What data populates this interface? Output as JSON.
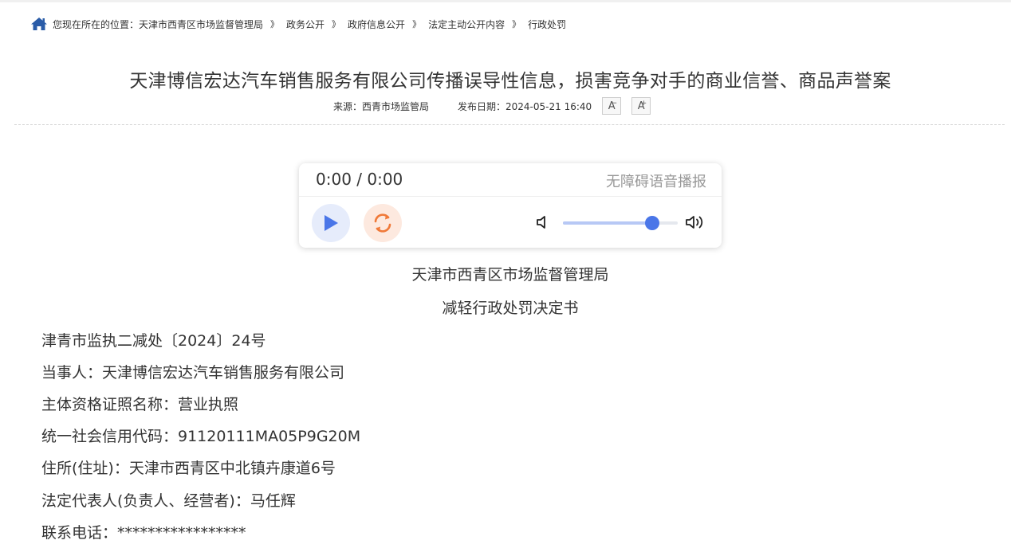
{
  "breadcrumb": {
    "prefix": "您现在所在的位置：",
    "items": [
      "天津市西青区市场监督管理局",
      "政务公开",
      "政府信息公开",
      "法定主动公开内容",
      "行政处罚"
    ],
    "separator": "》"
  },
  "article": {
    "title": "天津博信宏达汽车销售服务有限公司传播误导性信息，损害竞争对手的商业信誉、商品声誉案",
    "source": "来源：西青市场监管局",
    "date": "发布日期：2024-05-21 16:40",
    "font_decrease": "A",
    "font_decrease_mark": "−",
    "font_increase": "A",
    "font_increase_mark": "+"
  },
  "player": {
    "time": "0:00 / 0:00",
    "label": "无障碍语音播报",
    "volume_percent": 78
  },
  "document": {
    "agency": "天津市西青区市场监督管理局",
    "doc_title": "减轻行政处罚决定书",
    "lines": [
      "津青市监执二减处〔2024〕24号",
      "当事人：天津博信宏达汽车销售服务有限公司",
      "主体资格证照名称：营业执照",
      "统一社会信用代码：91120111MA05P9G20M",
      "住所(住址)：天津市西青区中北镇卉康道6号",
      "法定代表人(负责人、经营者)：马任辉",
      "联系电话：*****************"
    ]
  },
  "colors": {
    "home_icon": "#2a5ca8",
    "play": "#4a76e8",
    "replay": "#f07a3a"
  },
  "icons": [
    "home-icon",
    "play-icon",
    "replay-icon",
    "volume-low-icon",
    "volume-high-icon"
  ]
}
